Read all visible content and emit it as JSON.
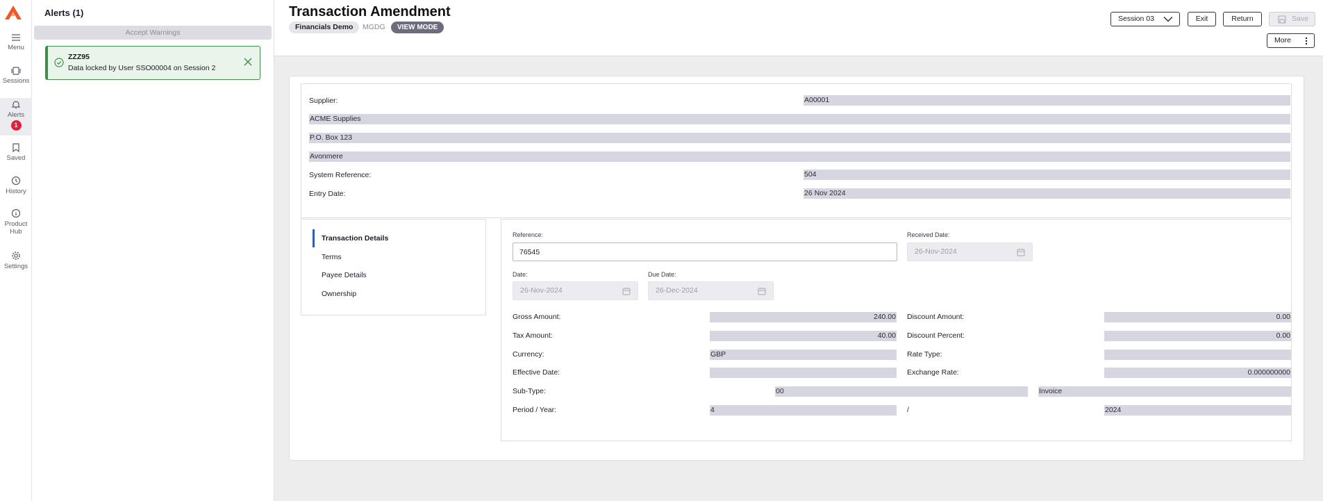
{
  "rail": {
    "items": [
      {
        "label": "Menu",
        "icon": "menu-icon"
      },
      {
        "label": "Sessions",
        "icon": "sessions-icon"
      },
      {
        "label": "Alerts",
        "icon": "bell-icon",
        "badge": "1"
      },
      {
        "label": "Saved",
        "icon": "bookmark-icon"
      },
      {
        "label": "History",
        "icon": "clock-icon"
      },
      {
        "label": "Product Hub",
        "icon": "info-icon"
      },
      {
        "label": "Settings",
        "icon": "gear-icon"
      }
    ]
  },
  "alerts": {
    "title": "Alerts (1)",
    "accept_label": "Accept Warnings",
    "items": [
      {
        "code": "ZZZ95",
        "message": "Data locked by User SSO00004 on Session 2"
      }
    ]
  },
  "header": {
    "title": "Transaction Amendment",
    "company": "Financials Demo",
    "code": "MGDG",
    "mode": "VIEW MODE",
    "session_label": "Session 03",
    "exit_label": "Exit",
    "return_label": "Return",
    "save_label": "Save",
    "more_label": "More"
  },
  "supplier": {
    "supplier_label": "Supplier:",
    "supplier_code": "A00001",
    "name": "ACME Supplies",
    "address1": "P.O. Box 123",
    "address2": "Avonmere",
    "system_ref_label": "System Reference:",
    "system_ref": "504",
    "entry_date_label": "Entry Date:",
    "entry_date": "26 Nov 2024"
  },
  "tabs": [
    {
      "label": "Transaction Details",
      "active": true
    },
    {
      "label": "Terms",
      "active": false
    },
    {
      "label": "Payee Details",
      "active": false
    },
    {
      "label": "Ownership",
      "active": false
    }
  ],
  "details": {
    "reference_label": "Reference:",
    "reference": "76545",
    "received_date_label": "Received Date:",
    "received_date": "26-Nov-2024",
    "date_label": "Date:",
    "date": "26-Nov-2024",
    "due_date_label": "Due Date:",
    "due_date": "26-Dec-2024",
    "gross_amount_label": "Gross Amount:",
    "gross_amount": "240.00",
    "discount_amount_label": "Discount Amount:",
    "discount_amount": "0.00",
    "tax_amount_label": "Tax Amount:",
    "tax_amount": "40.00",
    "discount_percent_label": "Discount Percent:",
    "discount_percent": "0.00",
    "currency_label": "Currency:",
    "currency": "GBP",
    "rate_type_label": "Rate Type:",
    "rate_type": "",
    "effective_date_label": "Effective Date:",
    "effective_date": "",
    "exchange_rate_label": "Exchange Rate:",
    "exchange_rate": "0.000000000",
    "sub_type_label": "Sub-Type:",
    "sub_type_code": "00",
    "sub_type_name": "Invoice",
    "period_year_label": "Period / Year:",
    "period": "4",
    "period_separator": "/",
    "year": "2024"
  },
  "colors": {
    "brand": "#f0582a",
    "badge": "#e0213c",
    "success_border": "#3f8d49",
    "success_bg": "#e9f5ea",
    "readonly_field": "#d6d6e0",
    "active_tab": "#2f5fb3",
    "mode_pill": "#6c6c7c"
  }
}
